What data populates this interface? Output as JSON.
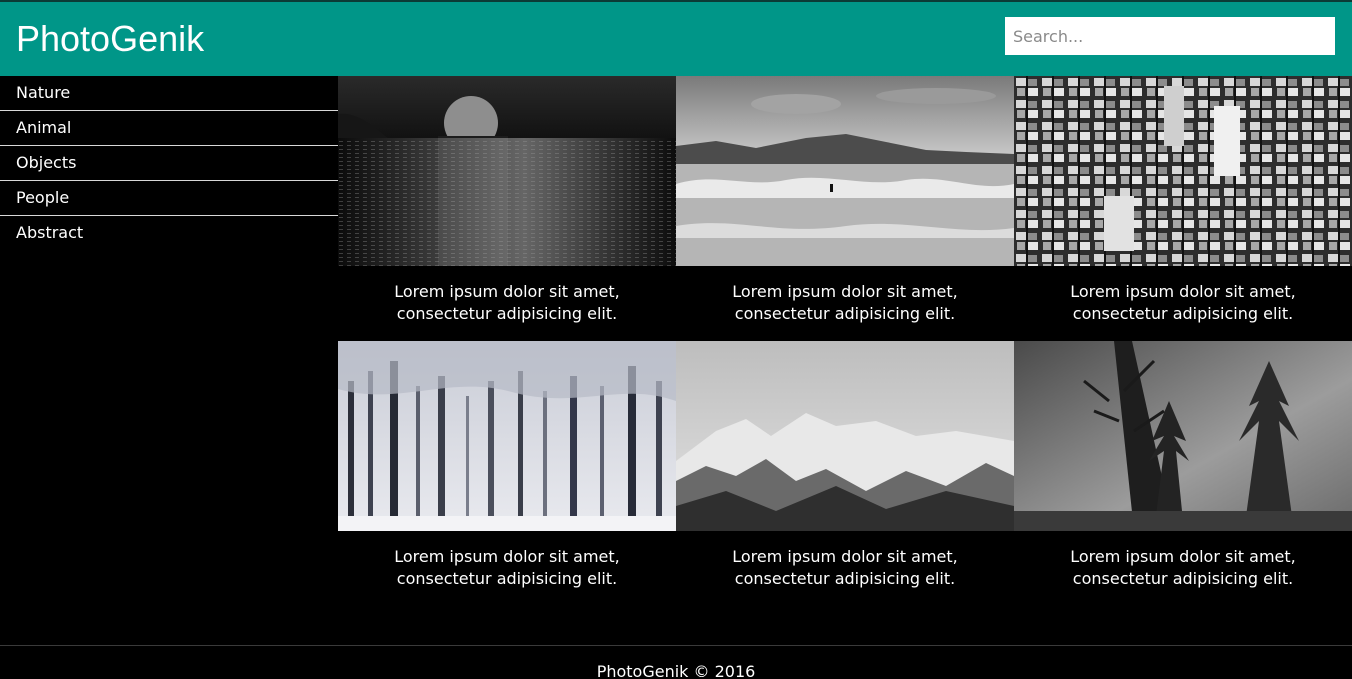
{
  "header": {
    "brand": "PhotoGenik",
    "search_placeholder": "Search...",
    "background_color": "#009688"
  },
  "sidebar": {
    "items": [
      {
        "label": "Nature"
      },
      {
        "label": "Animal"
      },
      {
        "label": "Objects"
      },
      {
        "label": "People"
      },
      {
        "label": "Abstract"
      }
    ]
  },
  "gallery": {
    "items": [
      {
        "subject": "moonrise-over-sea",
        "caption": "Lorem ipsum dolor sit amet, consectetur adipisicing elit."
      },
      {
        "subject": "surfer-waves-beach",
        "caption": "Lorem ipsum dolor sit amet, consectetur adipisicing elit."
      },
      {
        "subject": "city-skyscrapers-aerial",
        "caption": "Lorem ipsum dolor sit amet, consectetur adipisicing elit."
      },
      {
        "subject": "snowy-forest",
        "caption": "Lorem ipsum dolor sit amet, consectetur adipisicing elit."
      },
      {
        "subject": "snowy-mountains",
        "caption": "Lorem ipsum dolor sit amet, consectetur adipisicing elit."
      },
      {
        "subject": "foggy-pine-trees",
        "caption": "Lorem ipsum dolor sit amet, consectetur adipisicing elit."
      }
    ]
  },
  "footer": {
    "text": "PhotoGenik © 2016"
  }
}
